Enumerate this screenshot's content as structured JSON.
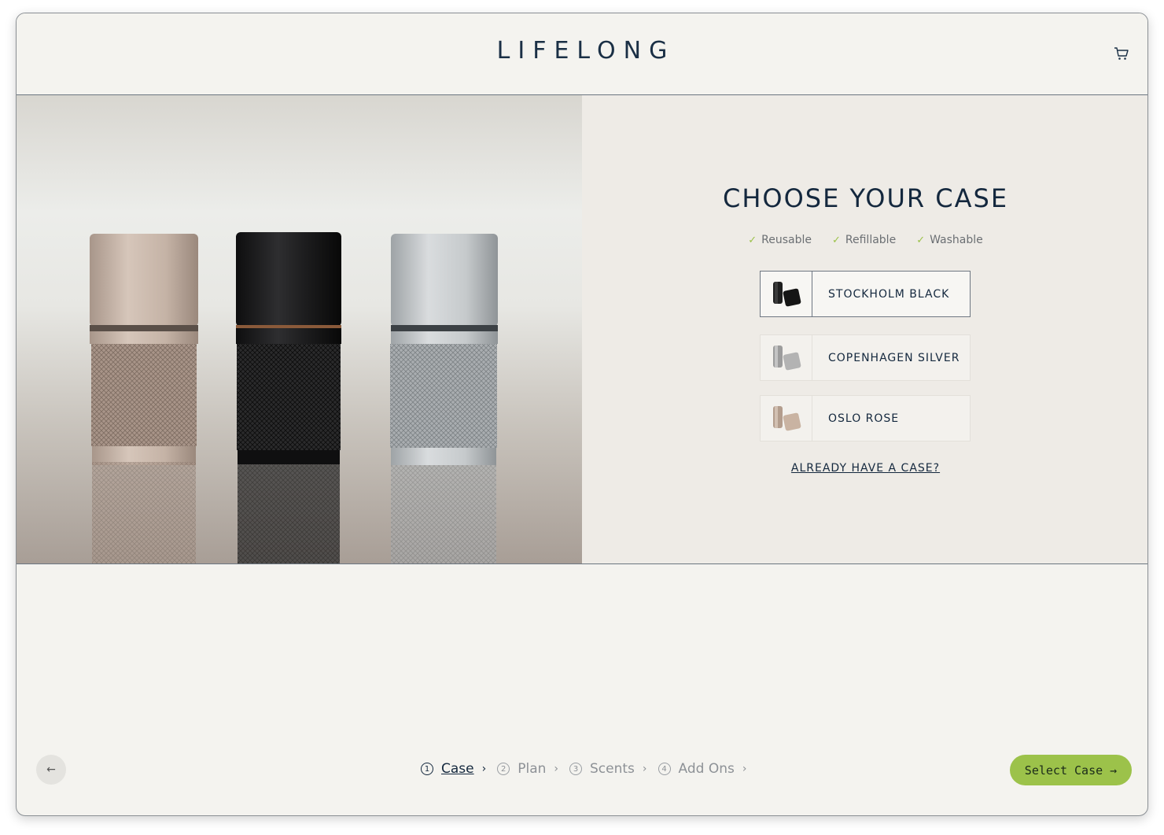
{
  "header": {
    "logo": "LIFELONG",
    "cart_icon": "cart-icon"
  },
  "panel": {
    "title": "CHOOSE YOUR CASE",
    "features": [
      "Reusable",
      "Refillable",
      "Washable"
    ],
    "options": [
      {
        "label": "STOCKHOLM BLACK",
        "selected": true,
        "color": "#1e1e1e"
      },
      {
        "label": "COPENHAGEN SILVER",
        "selected": false,
        "color": "#a9a9a9"
      },
      {
        "label": "OSLO ROSE",
        "selected": false,
        "color": "#bfa898"
      }
    ],
    "already_link": "ALREADY HAVE A CASE?"
  },
  "footer": {
    "back_icon": "arrow-left-icon",
    "steps": [
      {
        "num": "1",
        "name": "Case",
        "active": true
      },
      {
        "num": "2",
        "name": "Plan",
        "active": false
      },
      {
        "num": "3",
        "name": "Scents",
        "active": false
      },
      {
        "num": "4",
        "name": "Add Ons",
        "active": false
      }
    ],
    "cta_label": "Select Case →"
  },
  "colors": {
    "accent": "#9cc24a",
    "navy": "#14283e",
    "background": "#f4f3ef"
  }
}
